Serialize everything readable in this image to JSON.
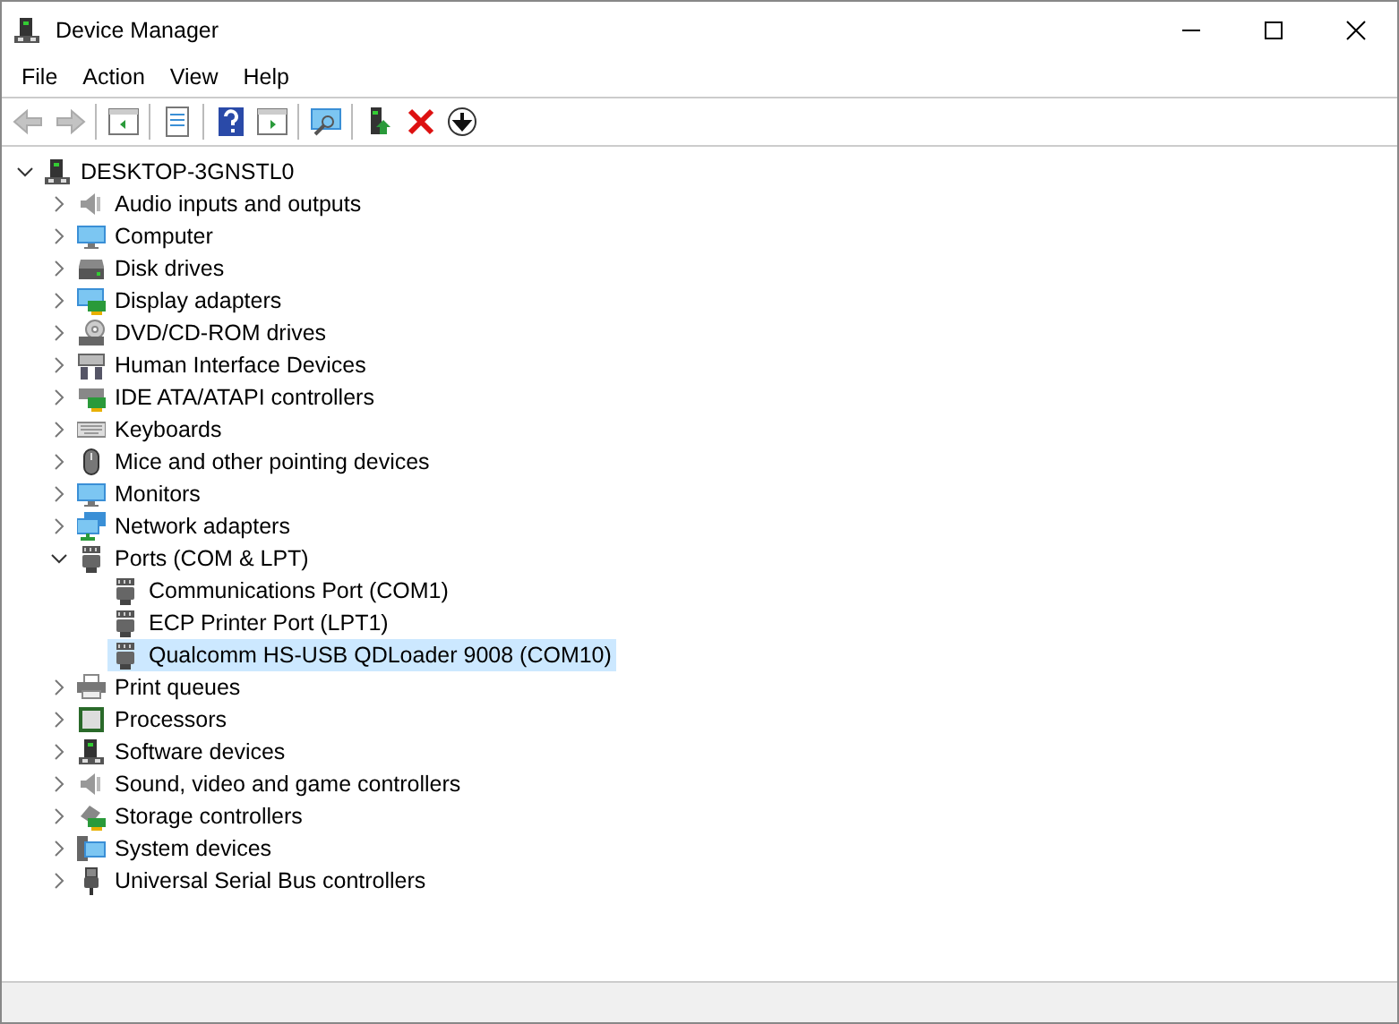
{
  "window": {
    "title": "Device Manager"
  },
  "menu": [
    "File",
    "Action",
    "View",
    "Help"
  ],
  "toolbar": [
    {
      "kind": "back",
      "disabled": true
    },
    {
      "kind": "forward",
      "disabled": true
    },
    {
      "kind": "separator"
    },
    {
      "kind": "tree-pane",
      "disabled": false
    },
    {
      "kind": "separator"
    },
    {
      "kind": "properties",
      "disabled": false
    },
    {
      "kind": "separator"
    },
    {
      "kind": "help",
      "disabled": false
    },
    {
      "kind": "action-pane",
      "disabled": false
    },
    {
      "kind": "separator"
    },
    {
      "kind": "scan",
      "disabled": false
    },
    {
      "kind": "separator"
    },
    {
      "kind": "update",
      "disabled": false
    },
    {
      "kind": "uninstall",
      "disabled": false
    },
    {
      "kind": "disable",
      "disabled": false
    }
  ],
  "tree": {
    "label": "DESKTOP-3GNSTL0",
    "kind": "computer-tower",
    "expanded": true,
    "selected": false,
    "children": [
      {
        "label": "Audio inputs and outputs",
        "kind": "speaker",
        "expanded": false,
        "selected": false
      },
      {
        "label": "Computer",
        "kind": "monitor",
        "expanded": false,
        "selected": false
      },
      {
        "label": "Disk drives",
        "kind": "disk",
        "expanded": false,
        "selected": false
      },
      {
        "label": "Display adapters",
        "kind": "display",
        "expanded": false,
        "selected": false
      },
      {
        "label": "DVD/CD-ROM drives",
        "kind": "dvd",
        "expanded": false,
        "selected": false
      },
      {
        "label": "Human Interface Devices",
        "kind": "hid",
        "expanded": false,
        "selected": false
      },
      {
        "label": "IDE ATA/ATAPI controllers",
        "kind": "ide",
        "expanded": false,
        "selected": false
      },
      {
        "label": "Keyboards",
        "kind": "keyboard",
        "expanded": false,
        "selected": false
      },
      {
        "label": "Mice and other pointing devices",
        "kind": "mouse",
        "expanded": false,
        "selected": false
      },
      {
        "label": "Monitors",
        "kind": "monitor",
        "expanded": false,
        "selected": false
      },
      {
        "label": "Network adapters",
        "kind": "network",
        "expanded": false,
        "selected": false
      },
      {
        "label": "Ports (COM & LPT)",
        "kind": "port",
        "expanded": true,
        "selected": false,
        "children": [
          {
            "label": "Communications Port (COM1)",
            "kind": "port",
            "selected": false
          },
          {
            "label": "ECP Printer Port (LPT1)",
            "kind": "port",
            "selected": false
          },
          {
            "label": "Qualcomm HS-USB QDLoader 9008 (COM10)",
            "kind": "port",
            "selected": true
          }
        ]
      },
      {
        "label": "Print queues",
        "kind": "printer",
        "expanded": false,
        "selected": false
      },
      {
        "label": "Processors",
        "kind": "processor",
        "expanded": false,
        "selected": false
      },
      {
        "label": "Software devices",
        "kind": "computer-tower",
        "expanded": false,
        "selected": false
      },
      {
        "label": "Sound, video and game controllers",
        "kind": "speaker",
        "expanded": false,
        "selected": false
      },
      {
        "label": "Storage controllers",
        "kind": "storage",
        "expanded": false,
        "selected": false
      },
      {
        "label": "System devices",
        "kind": "system",
        "expanded": false,
        "selected": false
      },
      {
        "label": "Universal Serial Bus controllers",
        "kind": "usb",
        "expanded": false,
        "selected": false
      }
    ]
  }
}
